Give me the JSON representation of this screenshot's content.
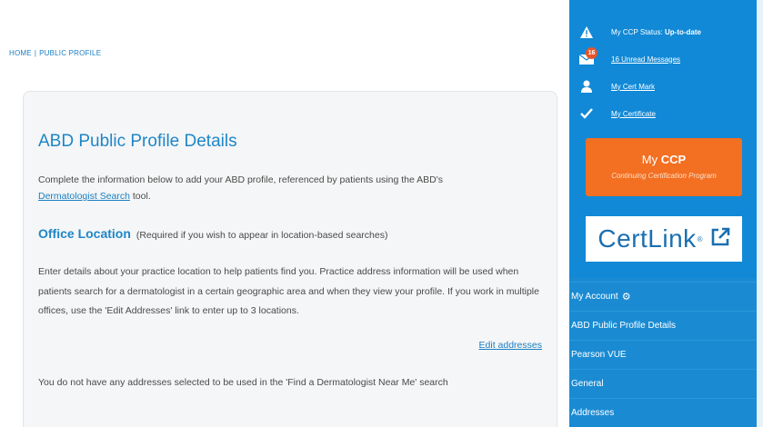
{
  "breadcrumb": {
    "home": "HOME",
    "separator": "|",
    "current": "PUBLIC PROFILE"
  },
  "main": {
    "title": "ABD Public Profile Details",
    "intro_text": "Complete the information below to add your ABD profile, referenced by patients using the ABD's",
    "intro_link": "Dermatologist Search",
    "intro_suffix": " tool.",
    "office_heading": "Office Location",
    "office_note": "(Required if you wish to appear in location-based searches)",
    "details_text": "Enter details about your practice location to help patients find you. Practice address information will be used when patients search for a dermatologist in a certain geographic area and when they view your profile. If you work in multiple offices, use the 'Edit Addresses' link to enter up to 3 locations.",
    "edit_addresses": "Edit addresses",
    "no_addresses": "You do not have any addresses selected to be used in the 'Find a Dermatologist Near Me' search"
  },
  "sidebar": {
    "status_label": "My CCP Status: ",
    "status_value": "Up-to-date",
    "unread_count": "16",
    "unread_messages": "16 Unread Messages",
    "cert_mark": "My Cert Mark",
    "certificate": "My Certificate",
    "ccp_my": "My ",
    "ccp_bold": "CCP",
    "ccp_sub": "Continuing Certification Program",
    "certlink_word": "CertLink",
    "certlink_tm": "®",
    "nav": [
      {
        "label": "My Account"
      },
      {
        "label": "ABD Public Profile Details"
      },
      {
        "label": "Pearson VUE"
      },
      {
        "label": "General"
      },
      {
        "label": "Addresses"
      }
    ]
  },
  "colors": {
    "accent": "#1e86c8",
    "sidebar": "#1a8bd3",
    "ccp_orange": "#f36f21"
  }
}
